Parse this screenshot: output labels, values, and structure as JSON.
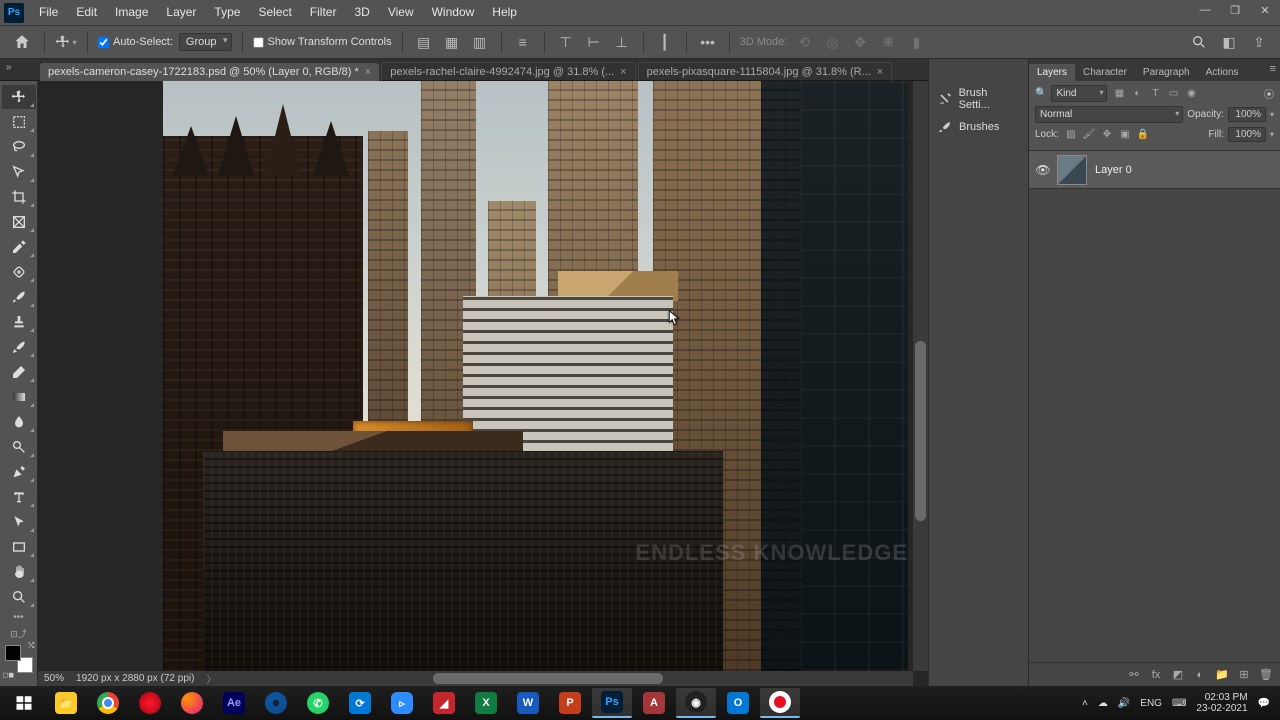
{
  "menu": [
    "File",
    "Edit",
    "Image",
    "Layer",
    "Type",
    "Select",
    "Filter",
    "3D",
    "View",
    "Window",
    "Help"
  ],
  "options": {
    "auto_select_label": "Auto-Select:",
    "auto_select_value": "Group",
    "show_transform": "Show Transform Controls",
    "mode_label": "3D Mode:"
  },
  "tabs": [
    {
      "title": "pexels-cameron-casey-1722183.psd @ 50% (Layer 0, RGB/8) *",
      "active": true
    },
    {
      "title": "pexels-rachel-claire-4992474.jpg @ 31.8% (...",
      "active": false
    },
    {
      "title": "pexels-pixasquare-1115804.jpg @ 31.8% (R...",
      "active": false
    }
  ],
  "status": {
    "zoom": "50%",
    "dims": "1920 px x 2880 px (72 ppi)"
  },
  "collapsed": [
    {
      "name": "Brush Setti...",
      "icon": "brush-settings"
    },
    {
      "name": "Brushes",
      "icon": "brushes"
    }
  ],
  "panel_tabs": [
    "Layers",
    "Character",
    "Paragraph",
    "Actions"
  ],
  "layers_panel": {
    "filter_kind": "Kind",
    "blend_mode": "Normal",
    "opacity_label": "Opacity:",
    "opacity_val": "100%",
    "lock_label": "Lock:",
    "fill_label": "Fill:",
    "fill_val": "100%",
    "layers": [
      {
        "name": "Layer 0",
        "visible": true
      }
    ]
  },
  "watermark": "ENDLESS KNOWLEDGE",
  "taskbar": {
    "lang": "ENG",
    "time": "02:03 PM",
    "date": "23-02-2021"
  }
}
